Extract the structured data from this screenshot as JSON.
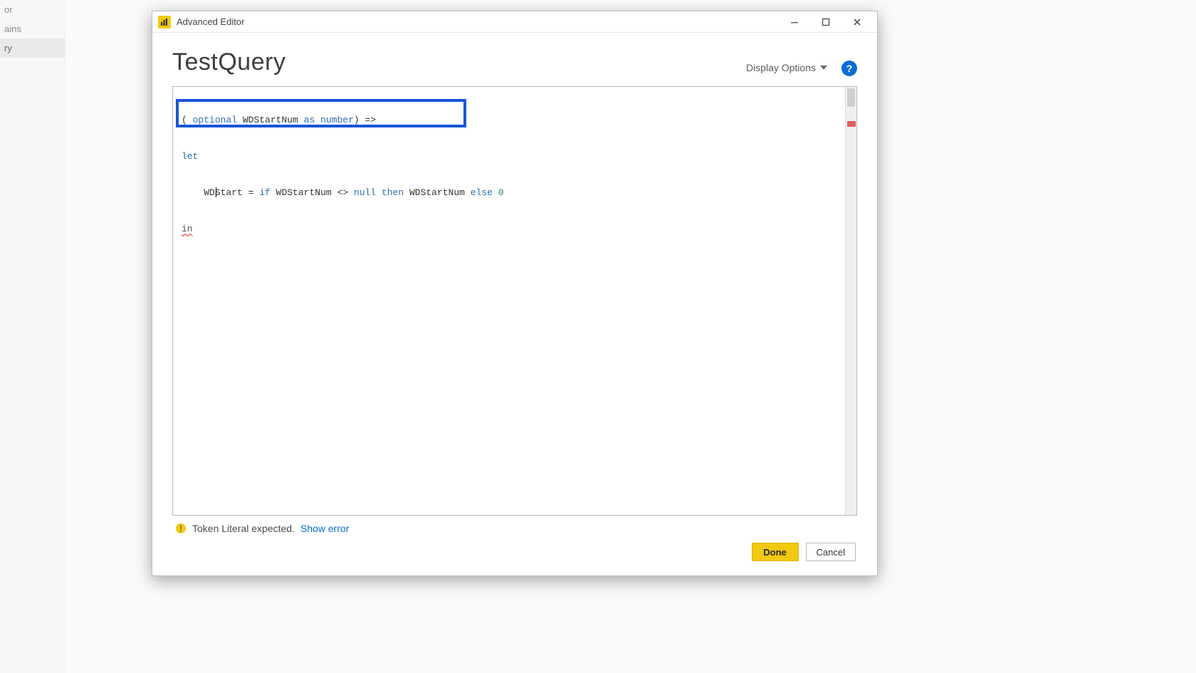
{
  "window": {
    "title": "Advanced Editor"
  },
  "background_sidebar": {
    "items": [
      "or",
      "ains",
      "ry"
    ]
  },
  "query": {
    "name": "TestQuery"
  },
  "toolbar": {
    "display_options_label": "Display Options"
  },
  "code": {
    "line1": {
      "paren_open": "(",
      "optional": " optional ",
      "ident": "WDStartNum ",
      "as": "as",
      "space1": " ",
      "type": "number",
      "paren_close": ") ",
      "arrow": "=>"
    },
    "line2": {
      "let": "let"
    },
    "line3": {
      "indent": "    ",
      "lhs": "WDStart",
      "eq": " = ",
      "if": "if",
      "sp1": " ",
      "rhs1": "WDStartNum",
      "sp2": " ",
      "neq": "<>",
      "sp3": " ",
      "null": "null",
      "sp4": " ",
      "then": "then",
      "sp5": " ",
      "rhs2": "WDStartNum",
      "sp6": " ",
      "else": "else",
      "sp7": " ",
      "zero": "0"
    },
    "line4": {
      "in": "in"
    }
  },
  "status": {
    "message": "Token Literal expected.",
    "show_error_label": "Show error"
  },
  "footer": {
    "done_label": "Done",
    "cancel_label": "Cancel"
  }
}
